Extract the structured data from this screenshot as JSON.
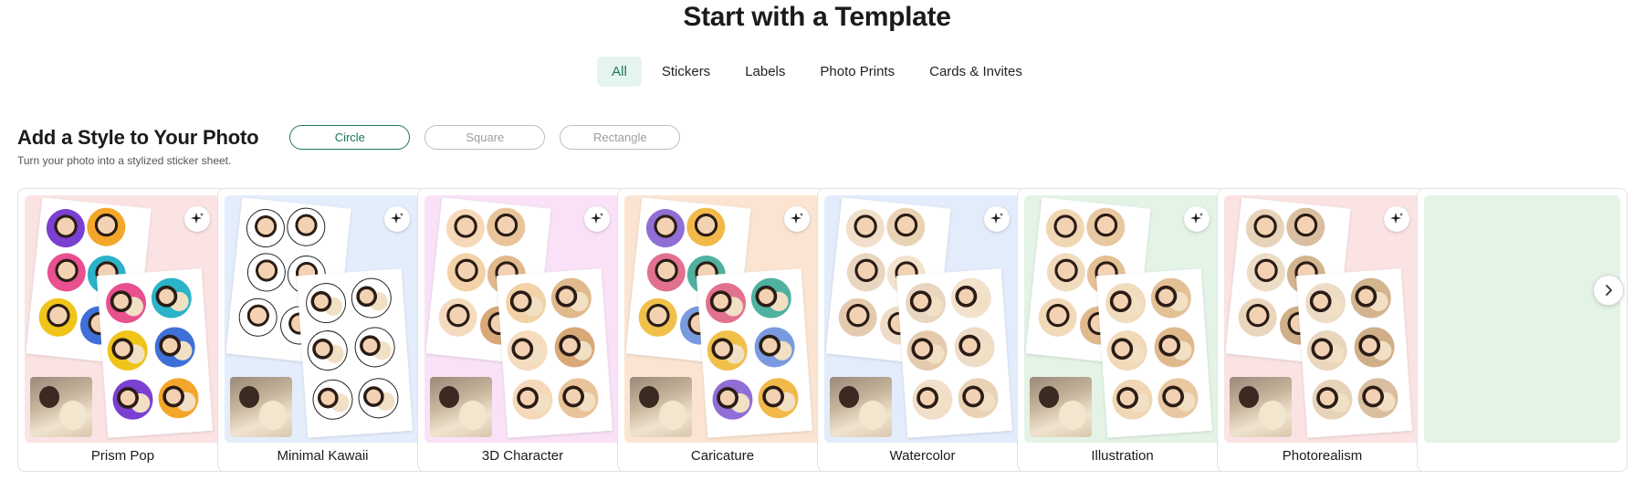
{
  "header": {
    "title": "Start with a Template"
  },
  "tabs": [
    {
      "label": "All",
      "active": true
    },
    {
      "label": "Stickers",
      "active": false
    },
    {
      "label": "Labels",
      "active": false
    },
    {
      "label": "Photo Prints",
      "active": false
    },
    {
      "label": "Cards & Invites",
      "active": false
    }
  ],
  "section": {
    "title": "Add a Style to Your Photo",
    "subtitle": "Turn your photo into a stylized sticker sheet.",
    "shapes": [
      {
        "label": "Circle",
        "selected": true
      },
      {
        "label": "Square",
        "selected": false
      },
      {
        "label": "Rectangle",
        "selected": false
      }
    ]
  },
  "templates": [
    {
      "label": "Prism Pop",
      "bg": "#fbe3e3",
      "sticker_colors": [
        "#7b3fd1",
        "#f4a62a",
        "#e8508f",
        "#2bb3c9",
        "#f0c419",
        "#3f6fd8"
      ]
    },
    {
      "label": "Minimal Kawaii",
      "bg": "#e4edfb",
      "sticker_colors": [
        "#ffffff",
        "#ffffff",
        "#ffffff",
        "#ffffff",
        "#ffffff",
        "#ffffff"
      ]
    },
    {
      "label": "3D Character",
      "bg": "#f9e2f7",
      "sticker_colors": [
        "#f5d9b8",
        "#e9c49a",
        "#f2d2a6",
        "#e0b98c",
        "#f5dcbf",
        "#d9a878"
      ]
    },
    {
      "label": "Caricature",
      "bg": "#fbe5d2",
      "sticker_colors": [
        "#8f6ed6",
        "#f2b94a",
        "#e2718f",
        "#4fb1a0",
        "#f0c04a",
        "#7a9ae0"
      ]
    },
    {
      "label": "Watercolor",
      "bg": "#e3ecfb",
      "sticker_colors": [
        "#f1dfcb",
        "#ead3b5",
        "#e9d6c0",
        "#f3e2cc",
        "#e5cbae",
        "#efdcc6"
      ]
    },
    {
      "label": "Illustration",
      "bg": "#e3f3e6",
      "sticker_colors": [
        "#f0d6b3",
        "#e8c8a0",
        "#f1dbbd",
        "#e4c095",
        "#f2d9b8",
        "#dfb98c"
      ]
    },
    {
      "label": "Photorealism",
      "bg": "#fbe3e3",
      "sticker_colors": [
        "#e7d3ba",
        "#d9bfa0",
        "#ecdcc6",
        "#d2b48e",
        "#e9d6bd",
        "#cfae88"
      ]
    }
  ],
  "icons": {
    "sparkle": "sparkle-icon",
    "next": "chevron-right-icon"
  },
  "colors": {
    "accent": "#197a56",
    "active_tab_bg": "#e6f4ee"
  }
}
